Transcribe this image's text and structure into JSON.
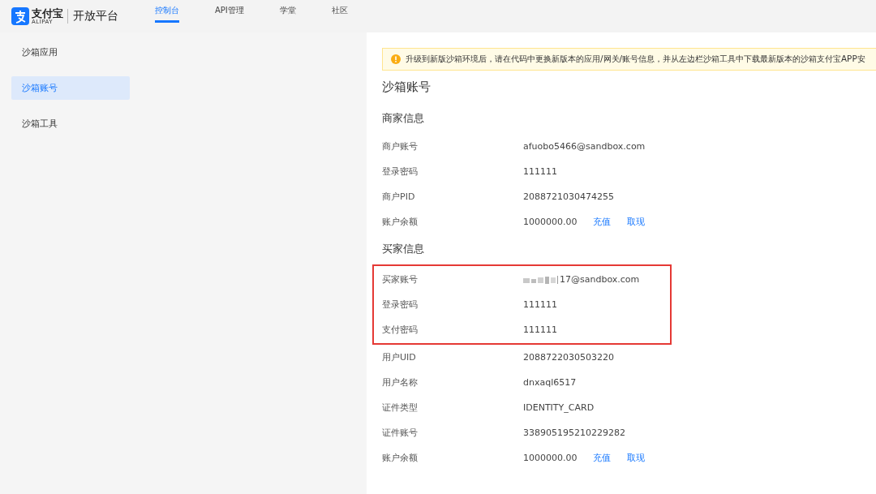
{
  "header": {
    "logo": {
      "brand": "支付宝",
      "sub": "ALIPAY"
    },
    "platform": "开放平台",
    "nav": [
      {
        "label": "控制台",
        "selected": true
      },
      {
        "label": "API管理",
        "selected": false
      },
      {
        "label": "学堂",
        "selected": false
      },
      {
        "label": "社区",
        "selected": false
      }
    ]
  },
  "sidebar": {
    "items": [
      {
        "label": "沙箱应用",
        "selected": false
      },
      {
        "label": "沙箱账号",
        "selected": true
      },
      {
        "label": "沙箱工具",
        "selected": false
      }
    ]
  },
  "notice": "升级到新版沙箱环境后，请在代码中更换新版本的应用/网关/账号信息，并从左边栏沙箱工具中下载最新版本的沙箱支付宝APP安",
  "title": "沙箱账号",
  "sections": [
    {
      "title": "商家信息",
      "rows": [
        {
          "label": "商户账号",
          "value": "afuobo5466@sandbox.com",
          "masked": false,
          "highlighted": false
        },
        {
          "label": "登录密码",
          "value": "111111",
          "masked": false,
          "highlighted": false
        },
        {
          "label": "商户PID",
          "value": "2088721030474255",
          "masked": false,
          "highlighted": false
        },
        {
          "label": "账户余额",
          "value": "1000000.00",
          "masked": false,
          "highlighted": false,
          "actions": [
            "充值",
            "取现"
          ]
        }
      ]
    },
    {
      "title": "买家信息",
      "rows": [
        {
          "label": "买家账号",
          "value": "17@sandbox.com",
          "masked": true,
          "highlighted": true
        },
        {
          "label": "登录密码",
          "value": "111111",
          "masked": false,
          "highlighted": true
        },
        {
          "label": "支付密码",
          "value": "111111",
          "masked": false,
          "highlighted": true
        },
        {
          "label": "用户UID",
          "value": "2088722030503220",
          "masked": false,
          "highlighted": false
        },
        {
          "label": "用户名称",
          "value": "dnxaql6517",
          "masked": false,
          "highlighted": false
        },
        {
          "label": "证件类型",
          "value": "IDENTITY_CARD",
          "masked": false,
          "highlighted": false
        },
        {
          "label": "证件账号",
          "value": "338905195210229282",
          "masked": false,
          "highlighted": false
        },
        {
          "label": "账户余额",
          "value": "1000000.00",
          "masked": false,
          "highlighted": false,
          "actions": [
            "充值",
            "取现"
          ]
        }
      ]
    }
  ]
}
